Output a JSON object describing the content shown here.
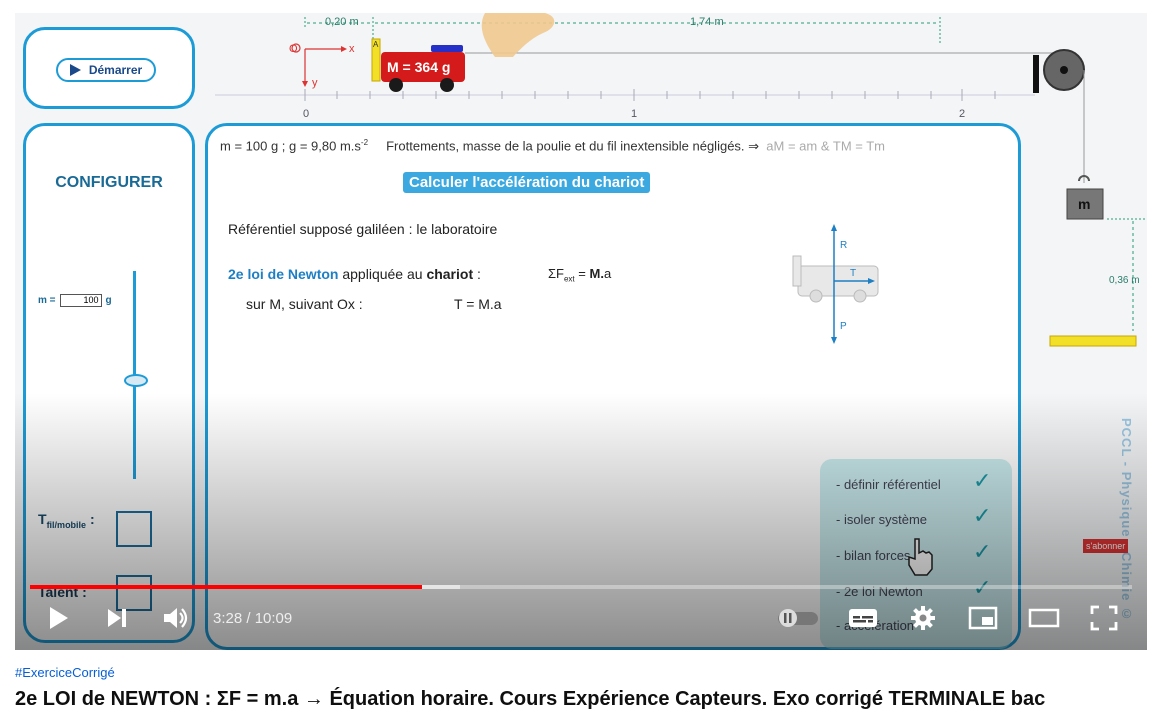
{
  "sim": {
    "start_label": "Démarrer",
    "config_title": "CONFIGURER",
    "mass_label": "m =",
    "mass_value": "100",
    "mass_unit": "g",
    "t_label_main": "T",
    "t_label_sub": "fil/mobile",
    "talent_label": "Talent :",
    "ruler": {
      "dist1": "0,20 m",
      "dist2": "1,74 m",
      "origin": "O",
      "x_axis": "x",
      "y_axis": "y",
      "ticks": [
        "0",
        "1",
        "2"
      ]
    },
    "cart_label": "M = 364 g",
    "hanging_mass_label": "m",
    "height_label": "0,36 m",
    "cart_letter": "A"
  },
  "lesson": {
    "hypothesis": "m = 100 g ; g = 9,80 m.s",
    "hypothesis_exp": "-2",
    "hypothesis_rest": "Frottements, masse de la poulie et du fil inextensible négligés. ⇒",
    "hypothesis_grey": "aM = am   &   TM = Tm",
    "section_title": "Calculer l'accélération du chariot",
    "referential": "Référentiel supposé galiléen : le laboratoire",
    "newton_blue": "2e loi de Newton",
    "newton_mid": "appliquée au",
    "newton_bold": "chariot",
    "newton_colon": ":",
    "sum_formula_pre": "ΣF",
    "sum_formula_sub": "ext",
    "sum_formula_post": "= ",
    "sum_formula_bold": "M.",
    "sum_formula_end": "a",
    "along": "sur M, suivant Ox :",
    "t_equation": "T = M.a",
    "force_labels": {
      "r": "R",
      "t": "T",
      "p": "P"
    }
  },
  "checklist": [
    {
      "label": "- définir référentiel",
      "checked": true
    },
    {
      "label": "- isoler système",
      "checked": true
    },
    {
      "label": "- bilan forces",
      "checked": true
    },
    {
      "label": "- 2e loi Newton",
      "checked": true
    },
    {
      "label": "- accélération",
      "checked": false
    }
  ],
  "watermark": "PCCL - Physique - Chimie ©",
  "subscribe_label": "s'abonner",
  "player": {
    "current_time": "3:28",
    "duration": "10:09",
    "time_text": "3:28 / 10:09",
    "progress_fraction": 0.356
  },
  "video": {
    "hashtag": "#ExerciceCorrigé",
    "title": "2e LOI de NEWTON : ΣF = m.a → Équation horaire. Cours Expérience Capteurs. Exo corrigé TERMINALE bac"
  },
  "colors": {
    "accent": "#1d9bd6",
    "progress": "#ff0000",
    "cart": "#d41a1a",
    "weight_block": "#f2e028"
  }
}
